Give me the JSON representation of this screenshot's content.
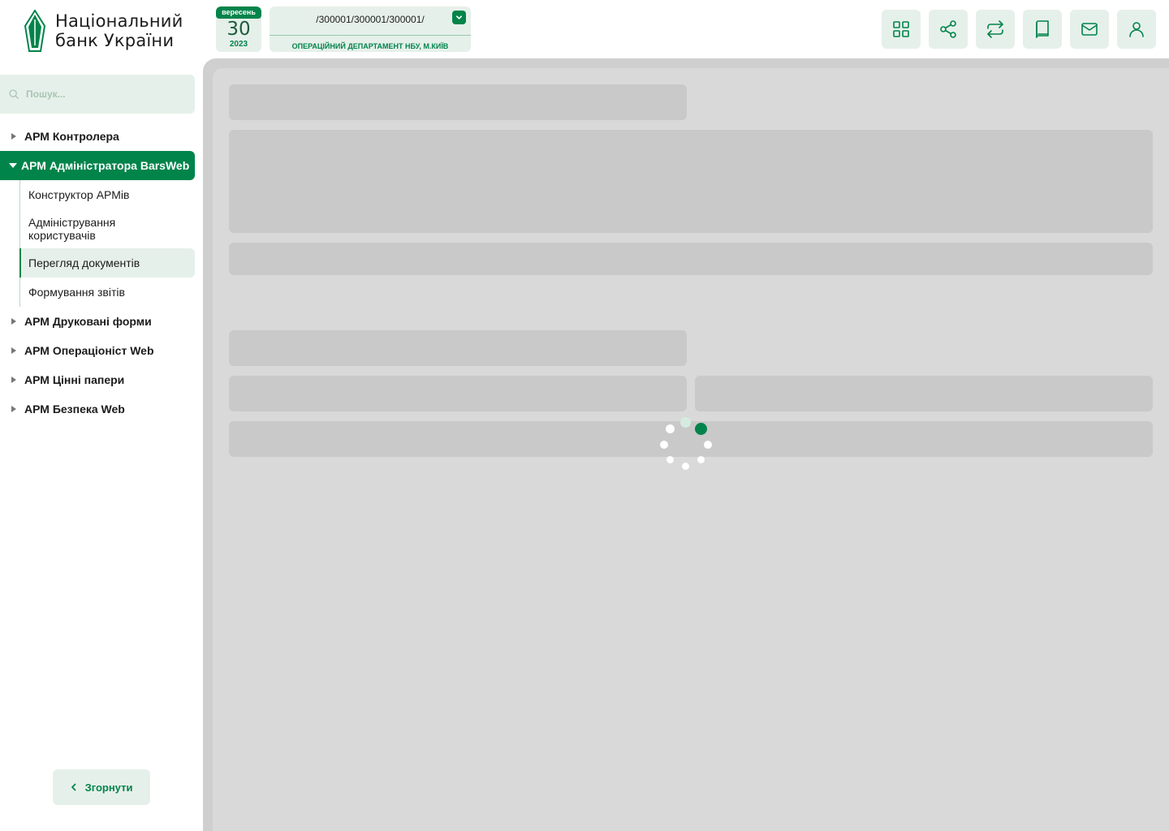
{
  "logo": {
    "line1": "Національний",
    "line2": "банк України"
  },
  "date": {
    "month": "вересень",
    "day": "30",
    "year": "2023"
  },
  "branch": {
    "code": "/300001/300001/300001/",
    "name": "ОПЕРАЦІЙНИЙ ДЕПАРТАМЕНТ НБУ, М.КИЇВ"
  },
  "toolbar": {
    "icons": [
      "grid-icon",
      "share-icon",
      "exchange-icon",
      "book-icon",
      "mail-icon",
      "user-icon"
    ]
  },
  "search": {
    "placeholder": "Пошук..."
  },
  "sidebar": {
    "items": [
      {
        "label": "АРМ Контролера",
        "expanded": false
      },
      {
        "label": "АРМ Адміністратора BarsWeb",
        "expanded": true,
        "children": [
          {
            "label": "Конструктор АРМів"
          },
          {
            "label": "Адміністрування користувачів"
          },
          {
            "label": "Перегляд документів",
            "selected": true
          },
          {
            "label": "Формування звітів"
          }
        ]
      },
      {
        "label": "АРМ Друковані форми",
        "expanded": false
      },
      {
        "label": "АРМ Операціоніст Web",
        "expanded": false
      },
      {
        "label": "АРМ Цінні папери",
        "expanded": false
      },
      {
        "label": "АРМ Безпека Web",
        "expanded": false
      }
    ],
    "collapse_label": "Згорнути"
  },
  "colors": {
    "accent": "#00844a",
    "accent_light": "#e6f0ea",
    "overlay": "#d9d9d9"
  },
  "loading": true
}
